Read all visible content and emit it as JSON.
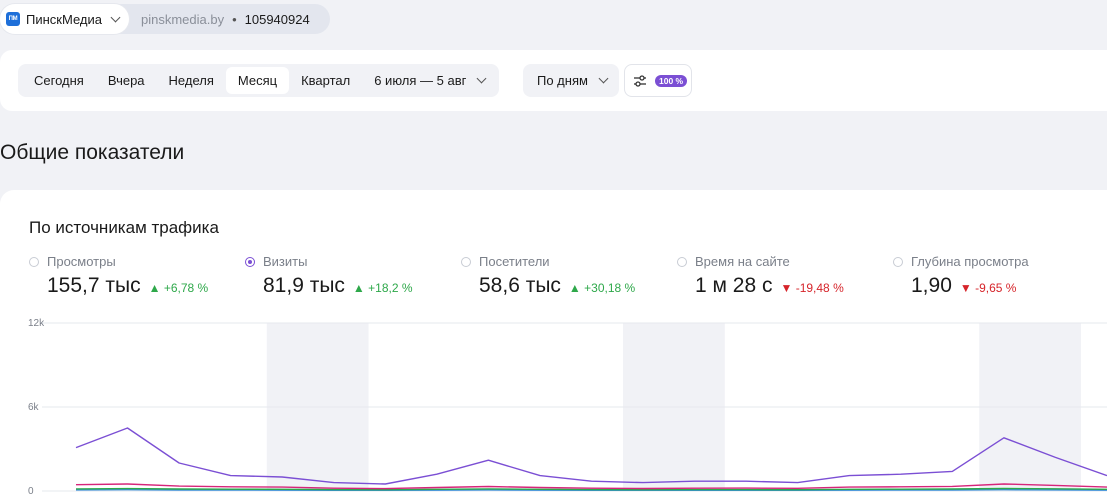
{
  "topbar": {
    "site_name": "ПинскМедиа",
    "logo_text": "ПМ",
    "domain": "pinskmedia.by",
    "separator": "•",
    "counter_id": "105940924"
  },
  "toolbar": {
    "period_tabs": [
      {
        "label": "Сегодня",
        "active": false
      },
      {
        "label": "Вчера",
        "active": false
      },
      {
        "label": "Неделя",
        "active": false
      },
      {
        "label": "Месяц",
        "active": true
      },
      {
        "label": "Квартал",
        "active": false
      }
    ],
    "date_range": "6 июля — 5 авг",
    "grouping": "По дням",
    "sampling": "100 %"
  },
  "section_title": "Общие показатели",
  "card": {
    "title": "По источникам трафика",
    "metrics": [
      {
        "label": "Просмотры",
        "value": "155,7 тыс",
        "delta": "+6,78 %",
        "trend": "up",
        "selected": false
      },
      {
        "label": "Визиты",
        "value": "81,9 тыс",
        "delta": "+18,2 %",
        "trend": "up",
        "selected": true
      },
      {
        "label": "Посетители",
        "value": "58,6 тыс",
        "delta": "+30,18 %",
        "trend": "up",
        "selected": false
      },
      {
        "label": "Время на сайте",
        "value": "1 м 28 с",
        "delta": "-19,48 %",
        "trend": "down",
        "selected": false
      },
      {
        "label": "Глубина просмотра",
        "value": "1,90",
        "delta": "-9,65 %",
        "trend": "down",
        "selected": false
      }
    ]
  },
  "colors": {
    "accent": "#7b4fd4",
    "up": "#2ea84a",
    "down": "#d6242a",
    "weekend": "#f1f2f6"
  },
  "chart_data": {
    "type": "line",
    "yticks": [
      "12k",
      "6k",
      "0"
    ],
    "ylim": [
      0,
      12000
    ],
    "x_days": 31,
    "weekend_bands": [
      [
        7.5,
        11.5
      ],
      [
        21.5,
        25.5
      ],
      [
        35.5,
        39.5
      ]
    ],
    "series": [
      {
        "color": "#7b4fd4",
        "values": [
          3100,
          4500,
          2000,
          1100,
          1000,
          600,
          500,
          1200,
          2200,
          1100,
          700,
          600,
          700,
          700,
          600,
          1100,
          1200,
          1400,
          3800,
          2400,
          1100
        ]
      },
      {
        "color": "#d6247a",
        "values": [
          450,
          500,
          350,
          300,
          280,
          200,
          170,
          250,
          320,
          250,
          200,
          180,
          200,
          210,
          190,
          280,
          300,
          330,
          500,
          400,
          280
        ]
      },
      {
        "color": "#2ea84a",
        "values": [
          150,
          170,
          140,
          130,
          120,
          100,
          90,
          120,
          150,
          120,
          100,
          90,
          100,
          100,
          90,
          120,
          130,
          140,
          180,
          160,
          120
        ]
      },
      {
        "color": "#3a8fd9",
        "values": [
          80,
          90,
          70,
          70,
          60,
          50,
          50,
          60,
          80,
          60,
          50,
          50,
          50,
          50,
          50,
          60,
          70,
          70,
          90,
          80,
          60
        ]
      }
    ]
  }
}
